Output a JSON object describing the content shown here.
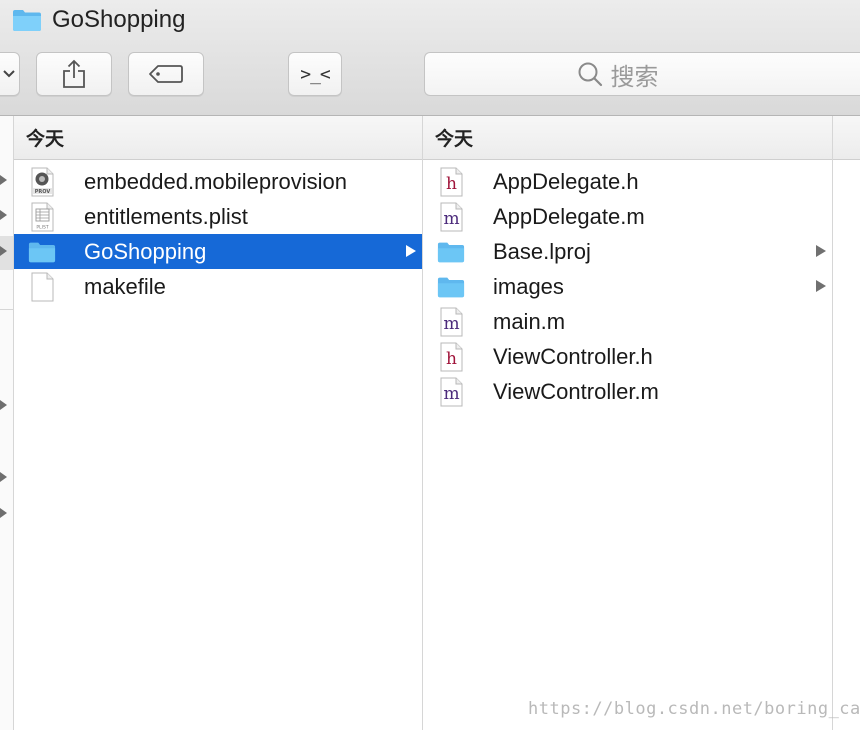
{
  "window": {
    "title": "GoShopping"
  },
  "toolbar": {
    "terminal_glyph": ">_<",
    "search_placeholder": "搜索"
  },
  "columns": [
    {
      "header": "今天",
      "items": [
        {
          "name": "embedded.mobileprovision",
          "icon": "provision-file-icon",
          "has_children": false,
          "selected": false
        },
        {
          "name": "entitlements.plist",
          "icon": "plist-file-icon",
          "has_children": false,
          "selected": false
        },
        {
          "name": "GoShopping",
          "icon": "folder-icon",
          "has_children": true,
          "selected": true
        },
        {
          "name": "makefile",
          "icon": "blank-file-icon",
          "has_children": false,
          "selected": false
        }
      ]
    },
    {
      "header": "今天",
      "items": [
        {
          "name": "AppDelegate.h",
          "icon": "header-file-icon",
          "has_children": false,
          "selected": false
        },
        {
          "name": "AppDelegate.m",
          "icon": "implementation-file-icon",
          "has_children": false,
          "selected": false
        },
        {
          "name": "Base.lproj",
          "icon": "folder-icon",
          "has_children": true,
          "selected": false
        },
        {
          "name": "images",
          "icon": "folder-icon",
          "has_children": true,
          "selected": false
        },
        {
          "name": "main.m",
          "icon": "implementation-file-icon",
          "has_children": false,
          "selected": false
        },
        {
          "name": "ViewController.h",
          "icon": "header-file-icon",
          "has_children": false,
          "selected": false
        },
        {
          "name": "ViewController.m",
          "icon": "implementation-file-icon",
          "has_children": false,
          "selected": false
        }
      ]
    }
  ],
  "icon_letters": {
    "header": "h",
    "implementation": "m",
    "provision": "PROV",
    "plist": "PLIST"
  },
  "colors": {
    "selection": "#1669d7",
    "folder": "#6cc6f5",
    "header_letter": "#a0143a",
    "implementation_letter": "#4b2a7b"
  },
  "watermark": "https://blog.csdn.net/boring_cat"
}
